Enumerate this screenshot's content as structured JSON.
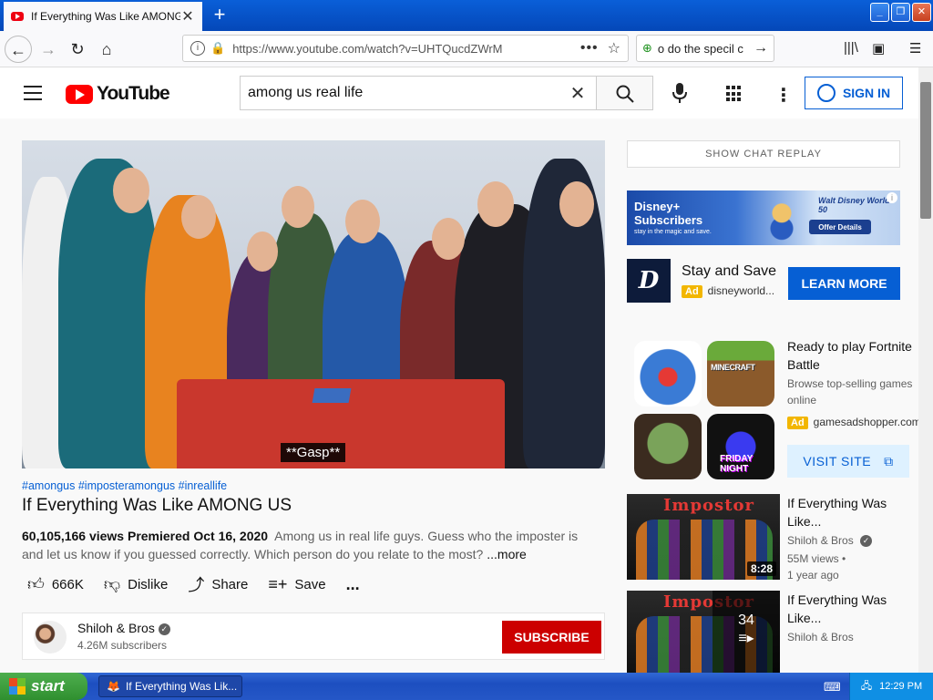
{
  "browser": {
    "tab_title": "If Everything Was Like AMONG US",
    "tab_close": "✕",
    "new_tab": "+",
    "url": "https://www.youtube.com/watch?v=UHTQucdZWrM",
    "search_box_text": "o do the specil c"
  },
  "youtube": {
    "logo_text": "YouTube",
    "search_query": "among us real life",
    "sign_in_label": "SIGN IN",
    "video": {
      "caption": "**Gasp**",
      "hashtags": "#amongus #imposteramongus #inreallife",
      "title": "If Everything Was Like AMONG US",
      "views_date": "60,105,166 views  Premiered Oct 16, 2020",
      "description_1": "Among us in real life guys. Guess who the imposter is",
      "description_2": "and let us know if you guessed correctly. Which person do you relate to the most?",
      "more_label": "...more"
    },
    "actions": {
      "like_count": "666K",
      "dislike_label": "Dislike",
      "share_label": "Share",
      "save_label": "Save",
      "more_label": "..."
    },
    "channel": {
      "name": "Shiloh & Bros",
      "subscribers": "4.26M subscribers",
      "subscribe_label": "SUBSCRIBE"
    },
    "sidebar": {
      "chat_replay_label": "SHOW CHAT REPLAY",
      "banner_ad": {
        "headline": "Disney+\nSubscribers",
        "tagline": "stay in the magic and save.",
        "brand": "Walt Disney World 50",
        "offer_label": "Offer Details"
      },
      "promo": {
        "logo": "D",
        "title": "Stay and Save",
        "ad_badge": "Ad",
        "url": "disneyworld...",
        "cta": "LEARN MORE"
      },
      "game_ad": {
        "title": "Ready to play Fortnite Battle",
        "subtitle": "Browse top-selling games online",
        "ad_badge": "Ad",
        "url": "gamesadshopper.com",
        "cta": "VISIT SITE",
        "minecraft_label": "MINECRAFT",
        "fnf_label": "FRIDAY NIGHT"
      },
      "recommendations": [
        {
          "thumb_text": "Impostor",
          "title": "If Everything Was Like...",
          "channel": "Shiloh & Bros",
          "views": "55M views •",
          "age": "1 year ago",
          "duration": "8:28"
        },
        {
          "thumb_text": "Impostor",
          "title": "If Everything Was Like...",
          "channel": "Shiloh & Bros",
          "playlist_count": "34"
        }
      ]
    }
  },
  "taskbar": {
    "start_label": "start",
    "task_item": "If Everything Was Lik...",
    "clock": "12:29 PM"
  }
}
